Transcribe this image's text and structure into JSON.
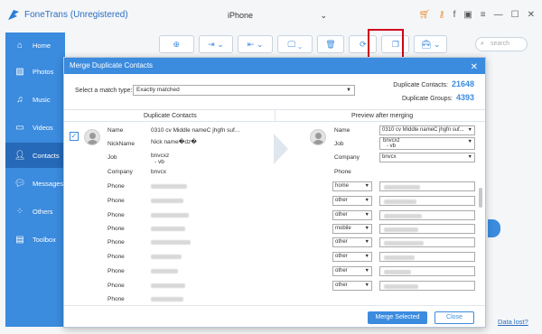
{
  "app": {
    "title": "FoneTrans (Unregistered)",
    "device_name": "iPhone",
    "search_placeholder": "search",
    "data_lost_link": "Data lost?",
    "accent_color": "#3b8bde"
  },
  "sidebar": {
    "items": [
      {
        "label": "Home",
        "icon": "home-icon"
      },
      {
        "label": "Photos",
        "icon": "photos-icon"
      },
      {
        "label": "Music",
        "icon": "music-icon"
      },
      {
        "label": "Videos",
        "icon": "videos-icon"
      },
      {
        "label": "Contacts",
        "icon": "contacts-icon",
        "active": true
      },
      {
        "label": "Messages",
        "icon": "messages-icon"
      },
      {
        "label": "Others",
        "icon": "others-icon"
      },
      {
        "label": "Toolbox",
        "icon": "toolbox-icon"
      }
    ]
  },
  "dialog": {
    "title": "Merge Duplicate Contacts",
    "match_type_label": "Select a match type:",
    "match_type_value": "Exactly matched",
    "duplicate_contacts_label": "Duplicate Contacts:",
    "duplicate_contacts_value": "21648",
    "duplicate_groups_label": "Duplicate Groups:",
    "duplicate_groups_value": "4393",
    "col_left": "Duplicate Contacts",
    "col_right": "Preview after merging",
    "merge_button": "Merge Selected",
    "close_button": "Close"
  },
  "contact": {
    "labels": {
      "name": "Name",
      "nickname": "NickName",
      "job": "Job",
      "company": "Company",
      "phone": "Phone"
    },
    "name": "0310 cv Middle nameC jhgfn suf...",
    "nickname": "Nick name�dz�",
    "job_line1": "bnvcxz",
    "job_line2": "- vb",
    "company": "bnvcx",
    "preview_name": "0310 cv Middle nameC jhgfn suf...",
    "preview_job_line1": "bnvcxz",
    "preview_job_line2": "- vb",
    "preview_company": "bnvcx",
    "phone_types": [
      "home",
      "other",
      "other",
      "mobile",
      "other",
      "other",
      "other",
      "other"
    ]
  }
}
